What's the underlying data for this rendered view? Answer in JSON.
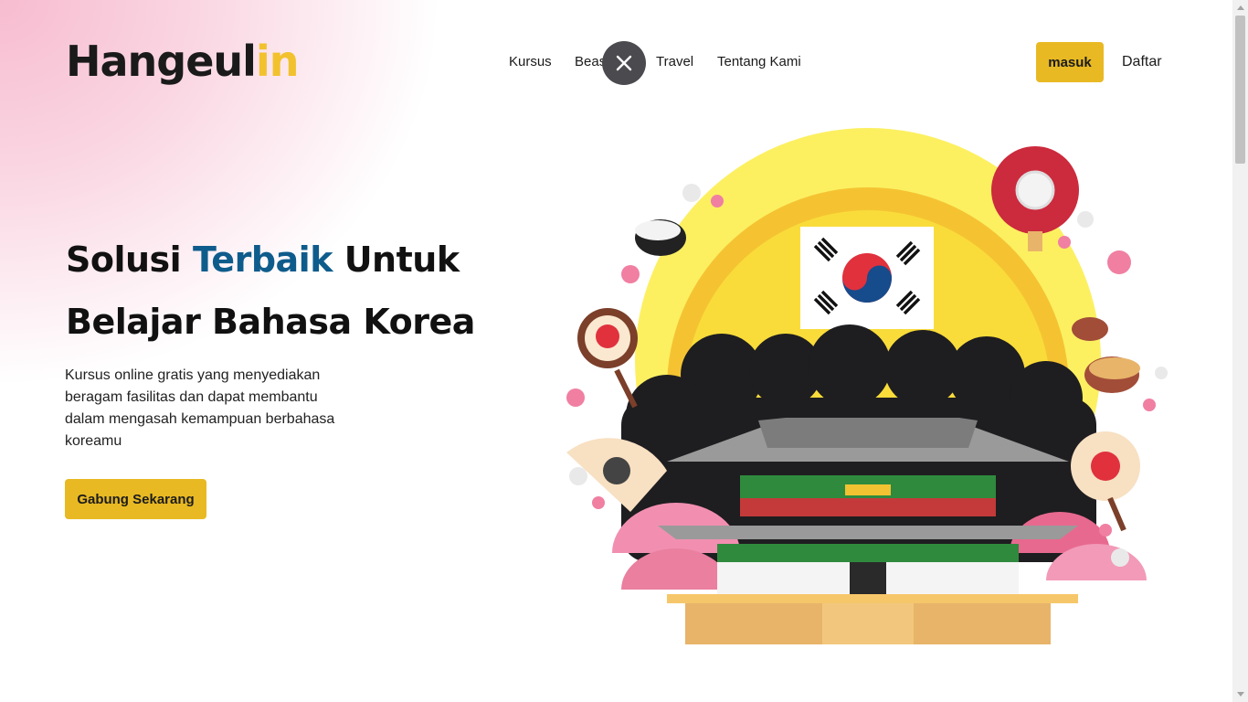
{
  "header": {
    "logo_main": "Hangeul",
    "logo_accent": "in",
    "nav": [
      "Kursus",
      "Beasiswa",
      "Travel",
      "Tentang Kami"
    ],
    "login_label": "masuk",
    "register_label": "Daftar"
  },
  "overlay": {
    "close_icon": "close-icon"
  },
  "hero": {
    "title_part1": "Solusi",
    "title_highlight": "Terbaik",
    "title_part2": "Untuk",
    "title_line2": "Belajar Bahasa Korea",
    "description": "Kursus online gratis yang menyediakan beragam fasilitas dan dapat membantu dalam mengasah kemampuan berbahasa koreamu",
    "cta_label": "Gabung Sekarang"
  },
  "colors": {
    "accent": "#e8b923",
    "highlight": "#0e5c8c",
    "pink": "#f7bcd0"
  }
}
